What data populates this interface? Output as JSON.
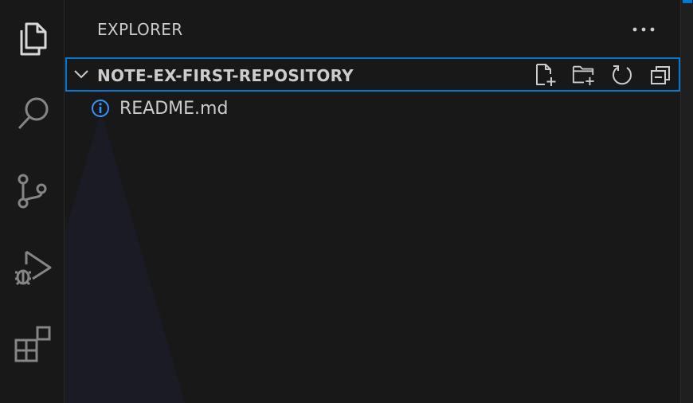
{
  "activity_bar": {
    "items": [
      {
        "icon": "files-icon",
        "active": true
      },
      {
        "icon": "search-icon",
        "active": false
      },
      {
        "icon": "source-control-icon",
        "active": false
      },
      {
        "icon": "run-debug-icon",
        "active": false
      },
      {
        "icon": "extensions-icon",
        "active": false
      }
    ]
  },
  "explorer": {
    "title": "EXPLORER",
    "more_icon": "ellipsis-icon"
  },
  "repo": {
    "name": "NOTE-EX-FIRST-REPOSITORY",
    "expanded": true,
    "actions": [
      {
        "icon": "new-file-icon"
      },
      {
        "icon": "new-folder-icon"
      },
      {
        "icon": "refresh-icon"
      },
      {
        "icon": "collapse-all-icon"
      }
    ]
  },
  "files": [
    {
      "name": "README.md",
      "icon": "info-icon"
    }
  ],
  "colors": {
    "background": "#181818",
    "text": "#cccccc",
    "icon": "#cccccc",
    "focus_border": "#0078d4",
    "info_icon": "#3794ff"
  }
}
